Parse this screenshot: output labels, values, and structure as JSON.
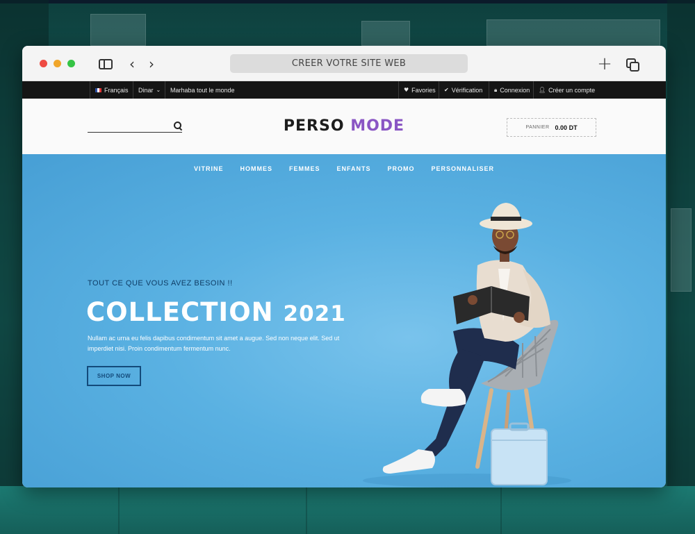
{
  "browser": {
    "url_bar_text": "CREER VOTRE SITE WEB"
  },
  "topbar": {
    "language": "Français",
    "currency": "Dinar",
    "greeting": "Marhaba tout le monde",
    "favorites": "Favories",
    "checkout": "Vérification",
    "login": "Connexion",
    "register": "Créer un compte"
  },
  "header": {
    "logo_part1": "PERSO",
    "logo_part2": "MODE",
    "cart_label": "PANNIER",
    "cart_amount": "0.00 DT"
  },
  "nav": [
    "VITRINE",
    "HOMMES",
    "FEMMES",
    "ENFANTS",
    "PROMO",
    "PERSONNALISER"
  ],
  "hero": {
    "tagline": "TOUT CE QUE VOUS AVEZ BESOIN !!",
    "title": "COLLECTION",
    "year": "2021",
    "description": "Nullam ac urna eu felis dapibus condimentum sit amet a augue. Sed non neque elit. Sed ut imperdiet nisi. Proin condimentum fermentum nunc.",
    "cta": "SHOP NOW"
  },
  "colors": {
    "logo_accent": "#8a56c4",
    "hero_bg": "#5ab1e2",
    "topbar_bg": "#151515"
  },
  "icons": [
    "sidebar-toggle-icon",
    "chevron-left-icon",
    "chevron-right-icon",
    "plus-icon",
    "tabs-icon",
    "search-icon",
    "heart-icon",
    "check-icon",
    "lock-icon",
    "user-icon",
    "flag-icon"
  ]
}
